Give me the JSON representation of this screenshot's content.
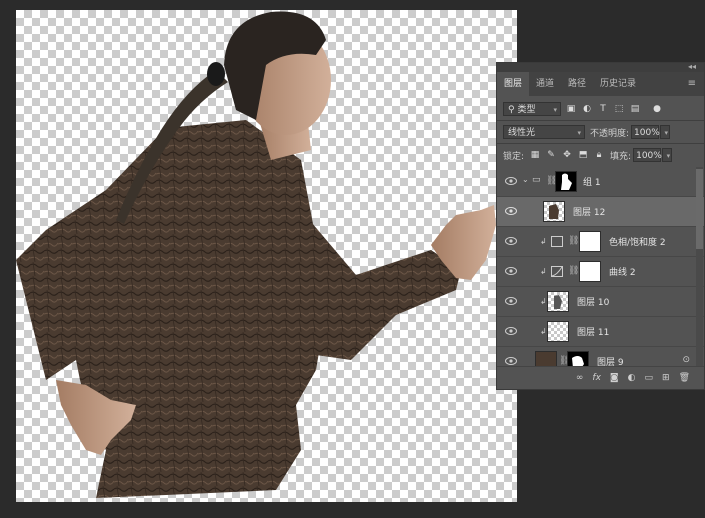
{
  "panel": {
    "tabs": [
      "图层",
      "通道",
      "路径",
      "历史记录"
    ],
    "active_tab": "图层",
    "filter": {
      "label": "类型"
    },
    "blend_mode": "线性光",
    "opacity": {
      "label": "不透明度:",
      "value": "100%"
    },
    "lock": {
      "label": "锁定:"
    },
    "fill": {
      "label": "填充:",
      "value": "100%"
    },
    "layers": [
      {
        "name": "组 1"
      },
      {
        "name": "图层 12"
      },
      {
        "name": "色相/饱和度 2"
      },
      {
        "name": "曲线 2"
      },
      {
        "name": "图层 10"
      },
      {
        "name": "图层 11"
      },
      {
        "name": "图层 9"
      }
    ],
    "icons": {
      "collapse": "double-chevron-icon",
      "menu": "panel-menu-icon",
      "filters": [
        "image-filter-icon",
        "adjustment-filter-icon",
        "text-filter-icon",
        "shape-filter-icon",
        "smart-object-filter-icon",
        "filter-toggle-icon"
      ],
      "locks": [
        "lock-pixels-icon",
        "lock-image-icon",
        "lock-position-icon",
        "lock-artboard-icon",
        "lock-all-icon"
      ],
      "bottom": [
        "link-layers-icon",
        "fx-icon",
        "add-mask-icon",
        "new-adjustment-icon",
        "new-group-icon",
        "new-layer-icon",
        "delete-icon"
      ]
    },
    "bottom_labels": {
      "link": "∞",
      "fx": "fx"
    }
  },
  "colors": {
    "app_bg": "#2b2b2b",
    "panel_bg": "#535353",
    "selected_row": "#696969",
    "bark": "#4a3b30"
  }
}
